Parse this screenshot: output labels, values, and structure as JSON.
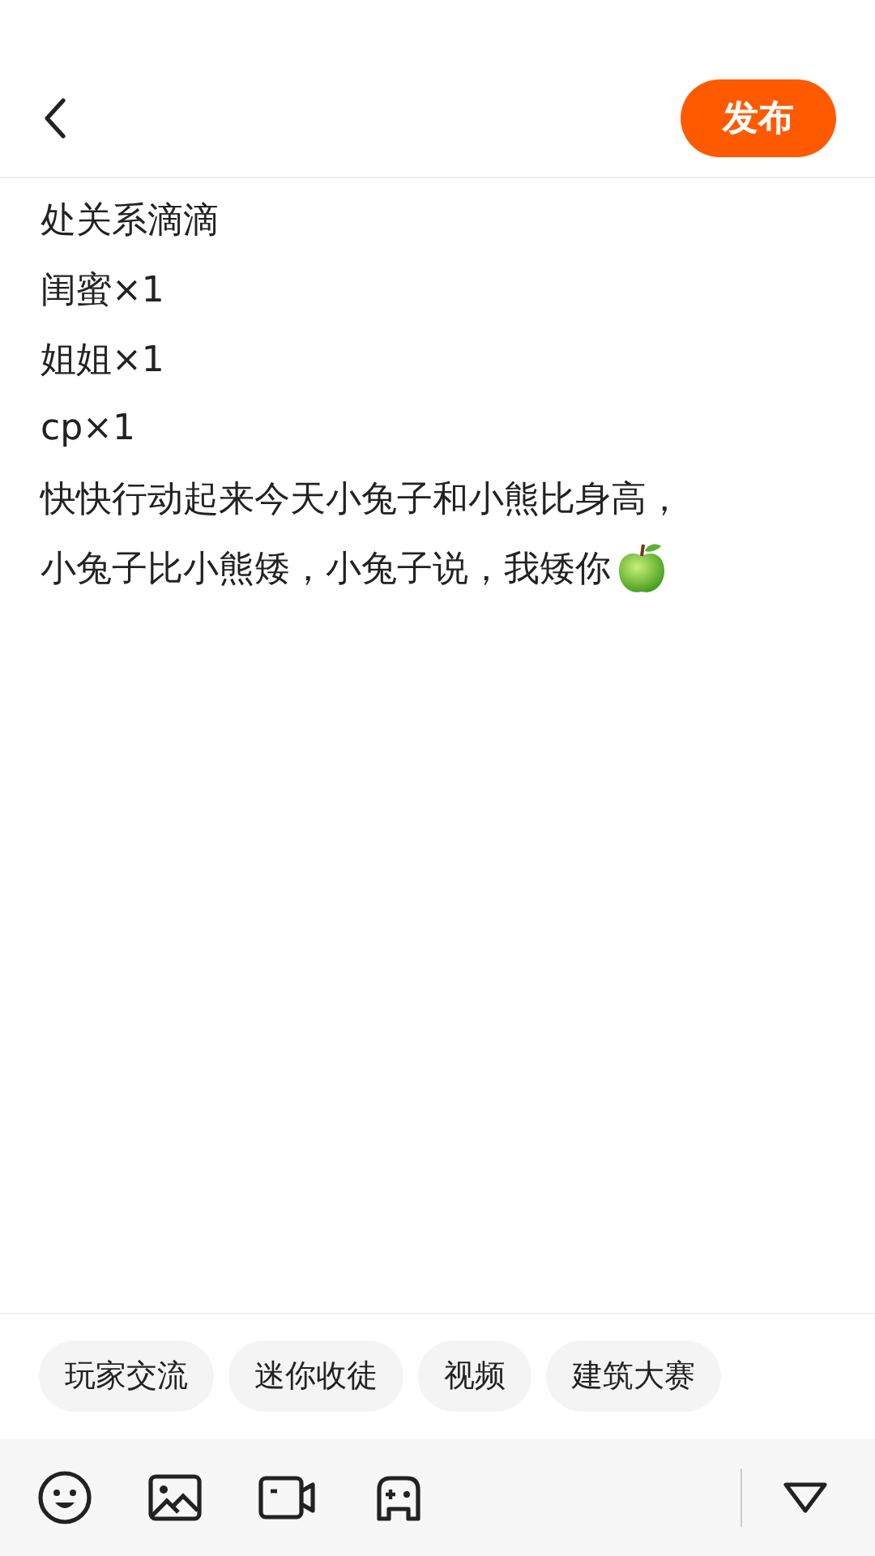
{
  "header": {
    "publish_button": "发布"
  },
  "body_lines": [
    "处关系滴滴",
    "闺蜜×1",
    "姐姐×1",
    "cp×1",
    "快快行动起来今天小兔子和小熊比身高，",
    "小兔子比小熊矮，小兔子说，我矮你"
  ],
  "topic_tags": [
    "玩家交流",
    "迷你收徒",
    "视频",
    "建筑大赛"
  ]
}
